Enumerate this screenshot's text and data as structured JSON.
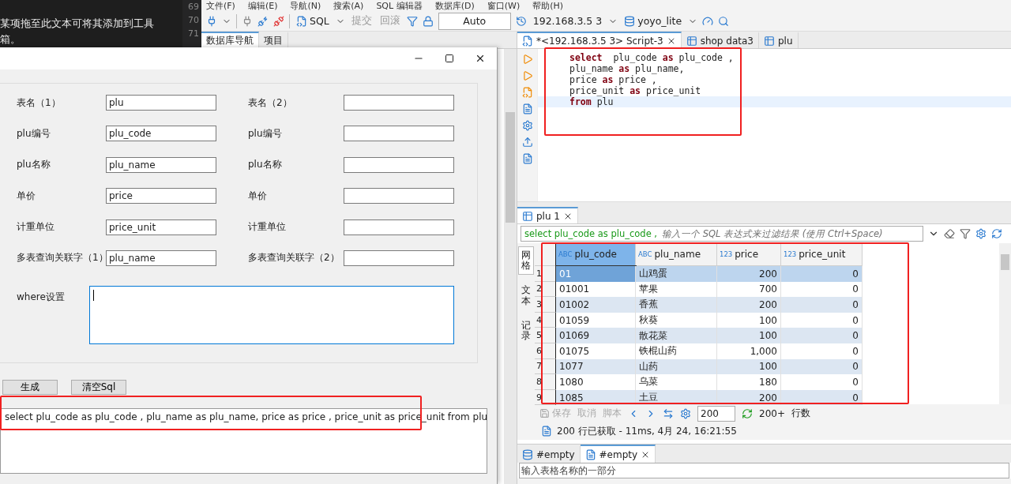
{
  "background_panel": {
    "text_lines": [
      "某项拖至此文本可将其添加到工具",
      "箱。"
    ],
    "line_numbers": [
      "69",
      "70",
      "71"
    ]
  },
  "menu_bar": [
    "文件(F)",
    "编辑(E)",
    "导航(N)",
    "搜索(A)",
    "SQL 编辑器",
    "数据库(D)",
    "窗口(W)",
    "帮助(H)"
  ],
  "toolbar": {
    "sql_button": "SQL",
    "commit_button": "提交",
    "rollback_button": "回滚",
    "mode": "Auto",
    "connection": "192.168.3.5 3",
    "database": "yoyo_lite"
  },
  "navigator_tabs": [
    {
      "label": "数据库导航",
      "selected": true
    },
    {
      "label": "项目",
      "selected": false
    }
  ],
  "editor_tabs": [
    {
      "label": "*<192.168.3.5 3> Script-3",
      "selected": true,
      "kind": "script"
    },
    {
      "label": "shop data3",
      "selected": false,
      "kind": "table"
    },
    {
      "label": "plu",
      "selected": false,
      "kind": "table"
    }
  ],
  "code_lines": [
    {
      "current": false,
      "tokens": [
        {
          "kind": "keyword",
          "text": "select"
        },
        {
          "kind": "plain",
          "text": "  plu_code "
        },
        {
          "kind": "keyword",
          "text": "as"
        },
        {
          "kind": "plain",
          "text": " plu_code ,"
        }
      ]
    },
    {
      "current": false,
      "tokens": [
        {
          "kind": "plain",
          "text": "plu_name "
        },
        {
          "kind": "keyword",
          "text": "as"
        },
        {
          "kind": "plain",
          "text": " plu_name,"
        }
      ]
    },
    {
      "current": false,
      "tokens": [
        {
          "kind": "plain",
          "text": "price "
        },
        {
          "kind": "keyword",
          "text": "as"
        },
        {
          "kind": "plain",
          "text": " price ,"
        }
      ]
    },
    {
      "current": false,
      "tokens": [
        {
          "kind": "plain",
          "text": "price_unit "
        },
        {
          "kind": "keyword",
          "text": "as"
        },
        {
          "kind": "plain",
          "text": " price_unit"
        }
      ]
    },
    {
      "current": true,
      "tokens": [
        {
          "kind": "keyword",
          "text": "from"
        },
        {
          "kind": "plain",
          "text": " plu"
        }
      ]
    }
  ],
  "results": {
    "tab": "plu 1",
    "filter_query": "select plu_code as plu_code ,",
    "filter_placeholder": "输入一个 SQL 表达式来过滤结果 (使用 Ctrl+Space)",
    "side_tabs": [
      {
        "label": "网格",
        "selected": true
      },
      {
        "label": "文本",
        "selected": false
      },
      {
        "label": "记录",
        "selected": false
      }
    ],
    "columns": [
      {
        "type": "ABC",
        "name": "plu_code",
        "selected": true
      },
      {
        "type": "ABC",
        "name": "plu_name",
        "selected": false
      },
      {
        "type": "123",
        "name": "price",
        "selected": false
      },
      {
        "type": "123",
        "name": "price_unit",
        "selected": false
      }
    ],
    "rows": [
      {
        "number": "1",
        "selected": true,
        "cells": [
          "01",
          "山鸡蛋",
          "200",
          "0"
        ]
      },
      {
        "number": "2",
        "selected": false,
        "cells": [
          "01001",
          "苹果",
          "700",
          "0"
        ]
      },
      {
        "number": "3",
        "selected": false,
        "cells": [
          "01002",
          "香蕉",
          "200",
          "0"
        ]
      },
      {
        "number": "4",
        "selected": false,
        "cells": [
          "01059",
          "秋葵",
          "100",
          "0"
        ]
      },
      {
        "number": "5",
        "selected": false,
        "cells": [
          "01069",
          "散花菜",
          "100",
          "0"
        ]
      },
      {
        "number": "6",
        "selected": false,
        "cells": [
          "01075",
          "铁棍山药",
          "1,000",
          "0"
        ]
      },
      {
        "number": "7",
        "selected": false,
        "cells": [
          "1077",
          "山药",
          "100",
          "0"
        ]
      },
      {
        "number": "8",
        "selected": false,
        "cells": [
          "1080",
          "乌菜",
          "180",
          "0"
        ]
      },
      {
        "number": "9",
        "selected": false,
        "cells": [
          "1085",
          "土豆",
          "200",
          "0"
        ]
      }
    ],
    "actions": [
      {
        "label": "保存",
        "disabled": true
      },
      {
        "label": "取消",
        "disabled": true
      },
      {
        "label": "脚本",
        "disabled": true
      }
    ],
    "fetch_size": "200",
    "fetch_more": "200+",
    "row_count_label": "行数",
    "status": "200 行已获取 - 11ms, 4月 24, 16:21:55"
  },
  "bottom_panel": {
    "tabs": [
      {
        "label": "#empty",
        "selected": false,
        "closable": false
      },
      {
        "label": "#empty",
        "selected": true,
        "closable": true
      }
    ],
    "search_placeholder": "输入表格名称的一部分"
  },
  "form": {
    "fields": [
      {
        "left": {
          "label": "表名（1）",
          "value": "plu"
        },
        "right": {
          "label": "表名（2）"
        }
      },
      {
        "left": {
          "label": "plu编号",
          "value": "plu_code"
        },
        "right": {
          "label": "plu编号"
        }
      },
      {
        "left": {
          "label": "plu名称",
          "value": "plu_name"
        },
        "right": {
          "label": "plu名称"
        }
      },
      {
        "left": {
          "label": "单价",
          "value": "price"
        },
        "right": {
          "label": "单价"
        }
      },
      {
        "left": {
          "label": "计重单位",
          "value": "price_unit"
        },
        "right": {
          "label": "计重单位"
        }
      },
      {
        "left": {
          "label": "多表查询关联字（1）",
          "value": "plu_name"
        },
        "right": {
          "label": "多表查询关联字（2）"
        }
      }
    ],
    "where_label": "where设置",
    "buttons": [
      "生成",
      "清空Sql"
    ],
    "output": "select  plu_code as plu_code , plu_name as plu_name, price as price , price_unit as price_unit from plu"
  }
}
